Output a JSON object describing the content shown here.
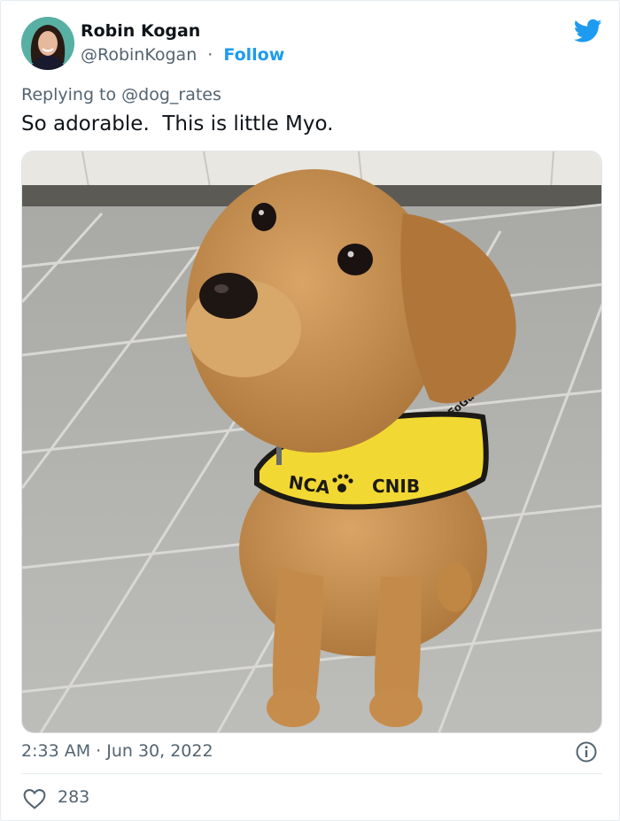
{
  "tweet": {
    "author_name": "Robin Kogan",
    "author_handle": "@RobinKogan",
    "separator": "·",
    "follow_label": "Follow",
    "replying_prefix": "Replying to ",
    "replying_to": "@dog_rates",
    "text": "So adorable.  This is little Myo.",
    "timestamp": "2:33 AM · Jun 30, 2022",
    "like_count": "283"
  },
  "image": {
    "vest_text_left": "NCA",
    "vest_text_right": "CNIB",
    "vest_text_side": "FoGu"
  },
  "icons": {
    "brand": "twitter-bird-icon",
    "info": "info-icon",
    "like": "heart-icon"
  },
  "colors": {
    "accent": "#1d9bf0",
    "text": "#0f1419",
    "secondary_text": "#536471",
    "vest_yellow": "#f2d833"
  }
}
